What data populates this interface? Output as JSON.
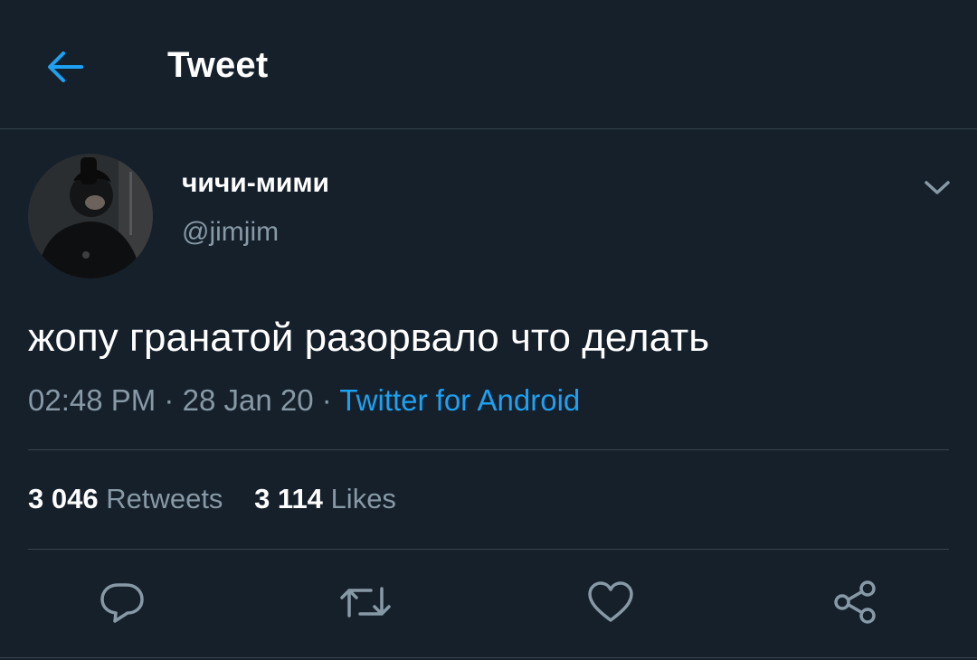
{
  "colors": {
    "background": "#15202b",
    "accent": "#1da1f2",
    "secondary_text": "#8899a6",
    "divider": "#38444d",
    "icon": "#8899a6"
  },
  "header": {
    "back_icon": "arrow-left-icon",
    "title": "Tweet"
  },
  "author": {
    "display_name": "чичи-мими",
    "handle": "@jimjim",
    "menu_icon": "chevron-down-icon"
  },
  "tweet": {
    "text": "жопу гранатой разорвало что делать",
    "time": "02:48 PM",
    "date": "28 Jan 20",
    "separator": "·",
    "source": "Twitter for Android"
  },
  "stats": {
    "retweets_count": "3 046",
    "retweets_label": "Retweets",
    "likes_count": "3 114",
    "likes_label": "Likes"
  },
  "actions": [
    {
      "icon": "reply-icon"
    },
    {
      "icon": "retweet-icon"
    },
    {
      "icon": "like-icon"
    },
    {
      "icon": "share-icon"
    }
  ]
}
